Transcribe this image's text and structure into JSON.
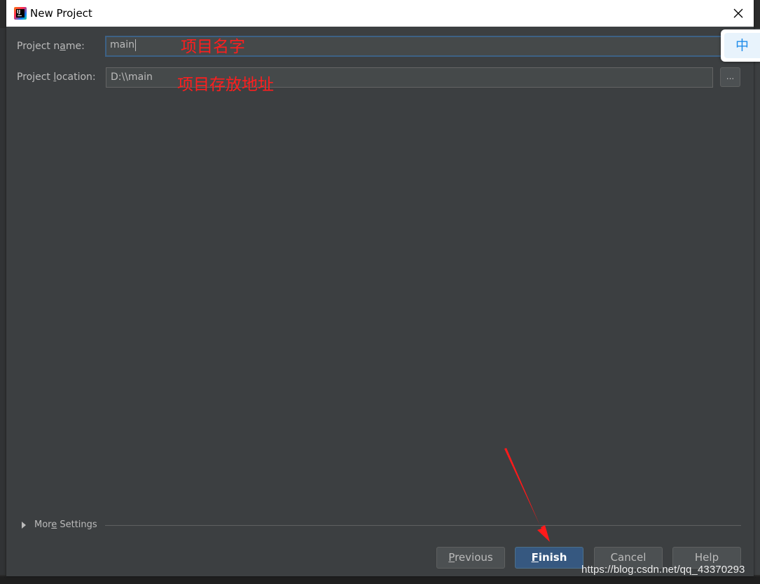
{
  "window": {
    "title": "New Project"
  },
  "form": {
    "project_name": {
      "label_pre": "Project n",
      "label_mnemonic": "a",
      "label_post": "me:",
      "value": "main"
    },
    "project_location": {
      "label_pre": "Project ",
      "label_mnemonic": "l",
      "label_post": "ocation:",
      "value": "D:\\\\main",
      "browse_label": "..."
    }
  },
  "annotations": {
    "name_note": "项目名字",
    "location_note": "项目存放地址"
  },
  "ime_indicator": "中",
  "more_settings": {
    "label_pre": "Mor",
    "label_mnemonic": "e",
    "label_post": " Settings"
  },
  "buttons": {
    "previous": {
      "mnemonic": "P",
      "rest": "revious"
    },
    "finish": {
      "mnemonic": "F",
      "rest": "inish"
    },
    "cancel": "Cancel",
    "help": "Help"
  },
  "watermark": "https://blog.csdn.net/qq_43370293",
  "colors": {
    "accent_focus": "#3d6185",
    "default_button": "#365880",
    "annotation_red": "#ff1e1e"
  }
}
